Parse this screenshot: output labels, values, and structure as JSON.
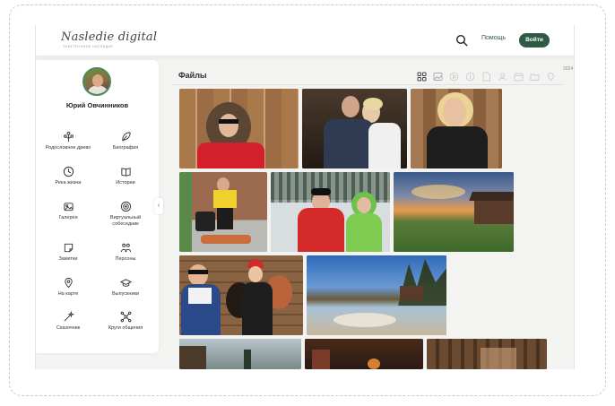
{
  "header": {
    "logo": "Nasledie digital",
    "logo_sub": "ЭЛЕКТРОННОЕ НАСЛЕДИЕ",
    "help_label": "Помощь",
    "login_label": "Войти"
  },
  "sidebar": {
    "username": "Юрий Овчинников",
    "items": [
      {
        "label": "Родословное древо",
        "icon": "tree-icon"
      },
      {
        "label": "Биография",
        "icon": "feather-icon"
      },
      {
        "label": "Река жизни",
        "icon": "clock-icon"
      },
      {
        "label": "Истории",
        "icon": "book-icon"
      },
      {
        "label": "Галерея",
        "icon": "gallery-icon"
      },
      {
        "label": "Виртуальный собеседник",
        "icon": "chat-icon"
      },
      {
        "label": "Заметки",
        "icon": "note-icon"
      },
      {
        "label": "Персоны",
        "icon": "persons-icon"
      },
      {
        "label": "На карте",
        "icon": "map-pin-icon"
      },
      {
        "label": "Выпускники",
        "icon": "graduation-cap-icon"
      },
      {
        "label": "Сказочник",
        "icon": "magic-wand-icon"
      },
      {
        "label": "Круги общения",
        "icon": "network-icon"
      }
    ]
  },
  "main": {
    "title": "Файлы",
    "year": "2024"
  },
  "colors": {
    "brand": "#2e5a44",
    "background": "#f3f3f1"
  }
}
